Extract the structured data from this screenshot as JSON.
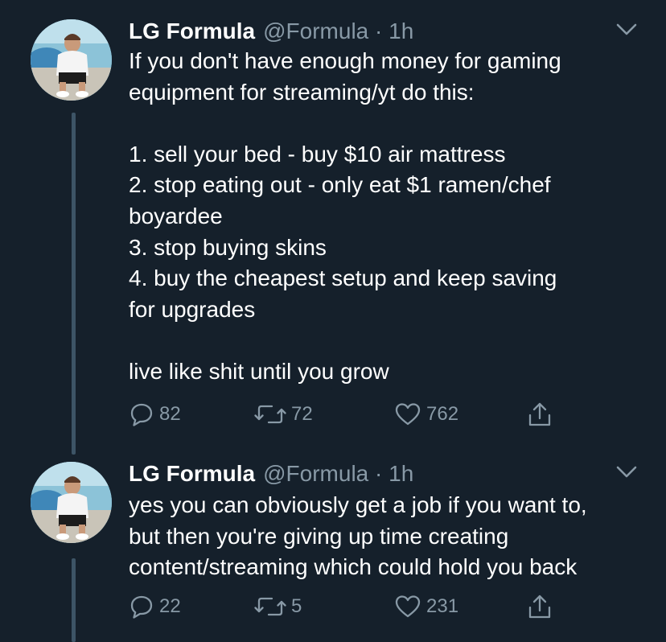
{
  "tweets": [
    {
      "display_name": "LG Formula",
      "handle": "@Formula",
      "separator": "·",
      "time": "1h",
      "lines": [
        "If you don't have enough money for gaming",
        "equipment for streaming/yt do this:",
        "",
        "1. sell your bed - buy $10 air mattress",
        "2. stop eating out - only eat $1 ramen/chef",
        "boyardee",
        "3. stop buying skins",
        "4. buy the cheapest setup and keep saving",
        "for upgrades",
        "",
        "live like shit until you grow"
      ],
      "replies": "82",
      "retweets": "72",
      "likes": "762"
    },
    {
      "display_name": "LG Formula",
      "handle": "@Formula",
      "separator": "·",
      "time": "1h",
      "lines": [
        "yes you can obviously get a job if you want to,",
        "but then you're giving up time creating",
        "content/streaming which could hold you back"
      ],
      "replies": "22",
      "retweets": "5",
      "likes": "231"
    }
  ],
  "icons": {
    "reply": "speech-bubble",
    "retweet": "retweet-arrows",
    "like": "heart-outline",
    "share": "share-up-arrow",
    "menu": "chevron-down"
  },
  "colors": {
    "background": "#15202b",
    "primary_text": "#ffffff",
    "secondary_text": "#8899a6",
    "thread_line": "#3d5466"
  }
}
